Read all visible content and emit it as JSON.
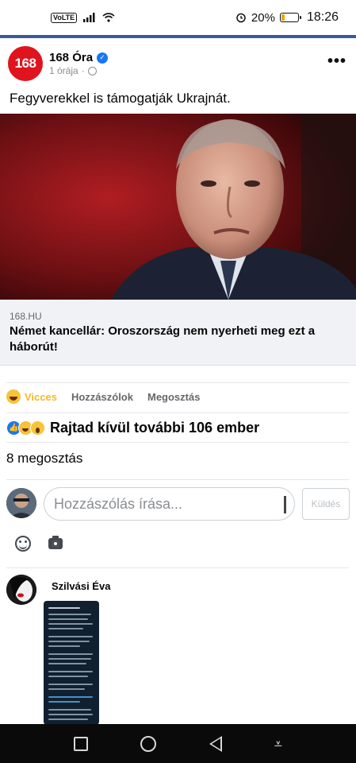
{
  "status_bar": {
    "network_label": "VoLTE",
    "battery_percent": "20%",
    "battery_level": 0.2,
    "time": "18:26",
    "icons": [
      "signal-icon",
      "wifi-icon",
      "alarm-icon",
      "battery-icon"
    ]
  },
  "post": {
    "logo_text": "168",
    "page_name": "168 Óra",
    "timestamp": "1 órája",
    "text": "Fegyverekkel is támogatják Ukrajnát.",
    "link": {
      "domain": "168.HU",
      "title": "Német kancellár: Oroszország nem nyerheti meg ezt a háborút!"
    }
  },
  "actions": {
    "reaction_label": "Vicces",
    "comment_label": "Hozzászólok",
    "share_label": "Megosztás"
  },
  "reactions": {
    "summary": "Rajtad kívül további 106 ember",
    "icons": [
      "like-icon",
      "haha-icon",
      "wow-icon"
    ]
  },
  "shares": {
    "label": "8 megosztás"
  },
  "composer": {
    "placeholder": "Hozzászólás írása...",
    "send_label": "Küldés"
  },
  "comment": {
    "author": "Szilvási Éva"
  },
  "colors": {
    "accent": "#3b5998",
    "brand_red": "#e0141e",
    "reaction_active": "#f7b928",
    "verified": "#1877f2"
  }
}
